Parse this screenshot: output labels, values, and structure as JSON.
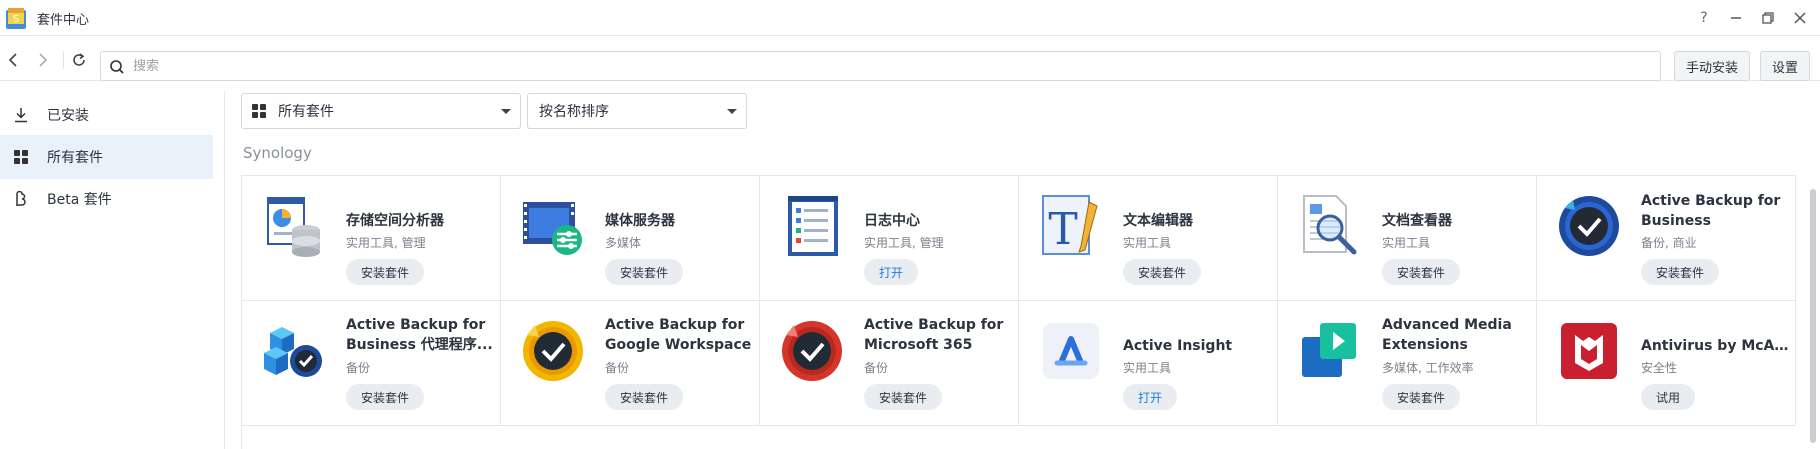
{
  "window": {
    "title": "套件中心",
    "controls": [
      "help-icon",
      "minimize-icon",
      "restore-icon",
      "close-icon"
    ]
  },
  "toolbar": {
    "search_placeholder": "搜索",
    "manual_install_label": "手动安装",
    "settings_label": "设置"
  },
  "sidebar": {
    "items": [
      {
        "label": "已安装",
        "icon": "download-icon",
        "active": false
      },
      {
        "label": "所有套件",
        "icon": "grid-icon",
        "active": true
      },
      {
        "label": "Beta 套件",
        "icon": "beta-icon",
        "active": false
      }
    ]
  },
  "filters": {
    "category": "所有套件",
    "sort": "按名称排序"
  },
  "section": {
    "title": "Synology"
  },
  "packages": [
    {
      "name": "存储空间分析器",
      "category": "实用工具, 管理",
      "action": "安装套件",
      "icon": "storage-analyzer-icon"
    },
    {
      "name": "媒体服务器",
      "category": "多媒体",
      "action": "安装套件",
      "icon": "media-server-icon"
    },
    {
      "name": "日志中心",
      "category": "实用工具, 管理",
      "action": "打开",
      "icon": "log-center-icon"
    },
    {
      "name": "文本编辑器",
      "category": "实用工具",
      "action": "安装套件",
      "icon": "text-editor-icon"
    },
    {
      "name": "文档查看器",
      "category": "实用工具",
      "action": "安装套件",
      "icon": "document-viewer-icon"
    },
    {
      "name": "Active Backup for Business",
      "category": "备份, 商业",
      "action": "安装套件",
      "icon": "active-backup-icon"
    },
    {
      "name": "Active Backup for Business 代理程序...",
      "category": "备份",
      "action": "安装套件",
      "icon": "backup-agent-icon"
    },
    {
      "name": "Active Backup for Google Workspace",
      "category": "备份",
      "action": "安装套件",
      "icon": "backup-google-icon"
    },
    {
      "name": "Active Backup for Microsoft 365",
      "category": "备份",
      "action": "安装套件",
      "icon": "backup-m365-icon"
    },
    {
      "name": "Active Insight",
      "category": "实用工具",
      "action": "打开",
      "icon": "active-insight-icon"
    },
    {
      "name": "Advanced Media Extensions",
      "category": "多媒体, 工作效率",
      "action": "安装套件",
      "icon": "media-extensions-icon"
    },
    {
      "name": "Antivirus by McAfee",
      "category": "安全性",
      "action": "试用",
      "icon": "mcafee-icon"
    }
  ],
  "colors": {
    "accent": "#1f7fe0",
    "active_bg": "#e9f1fb",
    "mcafee": "#c8202f"
  }
}
